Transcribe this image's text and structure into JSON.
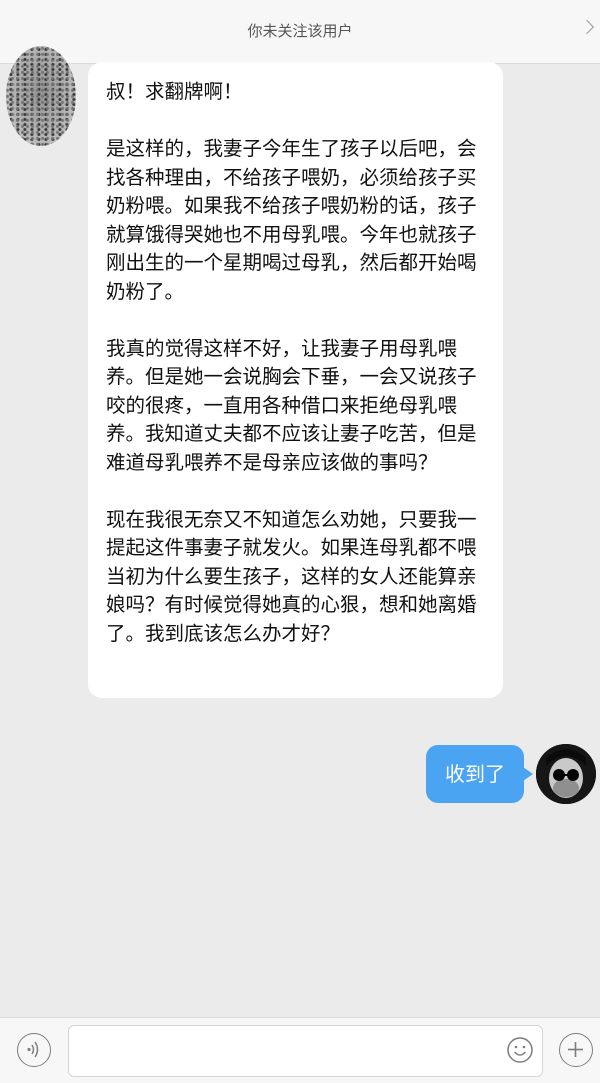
{
  "header": {
    "title": "你未关注该用户"
  },
  "messages": {
    "incoming": {
      "paragraphs": [
        "叔！求翻牌啊！",
        "是这样的，我妻子今年生了孩子以后吧，会找各种理由，不给孩子喂奶，必须给孩子买奶粉喂。如果我不给孩子喂奶粉的话，孩子就算饿得哭她也不用母乳喂。今年也就孩子刚出生的一个星期喝过母乳，然后都开始喝奶粉了。",
        "我真的觉得这样不好，让我妻子用母乳喂养。但是她一会说胸会下垂，一会又说孩子咬的很疼，一直用各种借口来拒绝母乳喂养。我知道丈夫都不应该让妻子吃苦，但是难道母乳喂养不是母亲应该做的事吗？",
        "现在我很无奈又不知道怎么劝她，只要我一提起这件事妻子就发火。如果连母乳都不喂当初为什么要生孩子，这样的女人还能算亲娘吗？有时候觉得她真的心狠，想和她离婚了。我到底该怎么办才好？"
      ]
    },
    "outgoing": {
      "text": "收到了",
      "bubble_color": "#4aa4f2"
    }
  },
  "composer": {
    "voice_icon": "voice-icon",
    "emoji_icon": "emoji-icon",
    "plus_icon": "plus-icon"
  }
}
